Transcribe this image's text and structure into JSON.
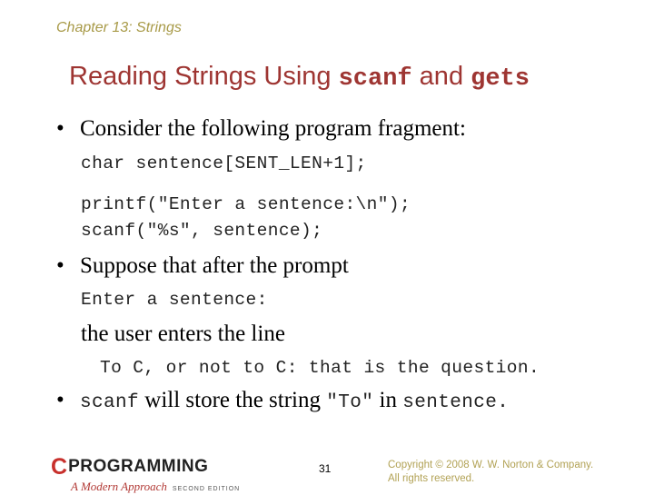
{
  "header": {
    "chapter": "Chapter 13: Strings"
  },
  "title": {
    "part1": "Reading Strings Using ",
    "code1": "scanf",
    "part2": " and ",
    "code2": "gets"
  },
  "body": {
    "bullet1": "Consider the following program fragment:",
    "code_line1": "char sentence[SENT_LEN+1];",
    "code_line2": "printf(\"Enter a sentence:\\n\");",
    "code_line3": "scanf(\"%s\", sentence);",
    "bullet2": "Suppose that after the prompt",
    "prompt_code": "Enter a sentence:",
    "user_enters": "the user enters the line",
    "input_line": "To C, or not to C: that is the question.",
    "bullet3": {
      "code_a": "scanf",
      "text_a": " will store the string ",
      "code_b": "\"To\"",
      "text_b": " in ",
      "code_c": "sentence",
      "text_c": "."
    },
    "bullet_glyph": "•"
  },
  "footer": {
    "page_number": "31",
    "copyright_line1": "Copyright © 2008 W. W. Norton & Company.",
    "copyright_line2": "All rights reserved.",
    "logo": {
      "c": "C",
      "main": "PROGRAMMING",
      "subtitle": "A Modern Approach",
      "edition": "SECOND EDITION"
    }
  }
}
